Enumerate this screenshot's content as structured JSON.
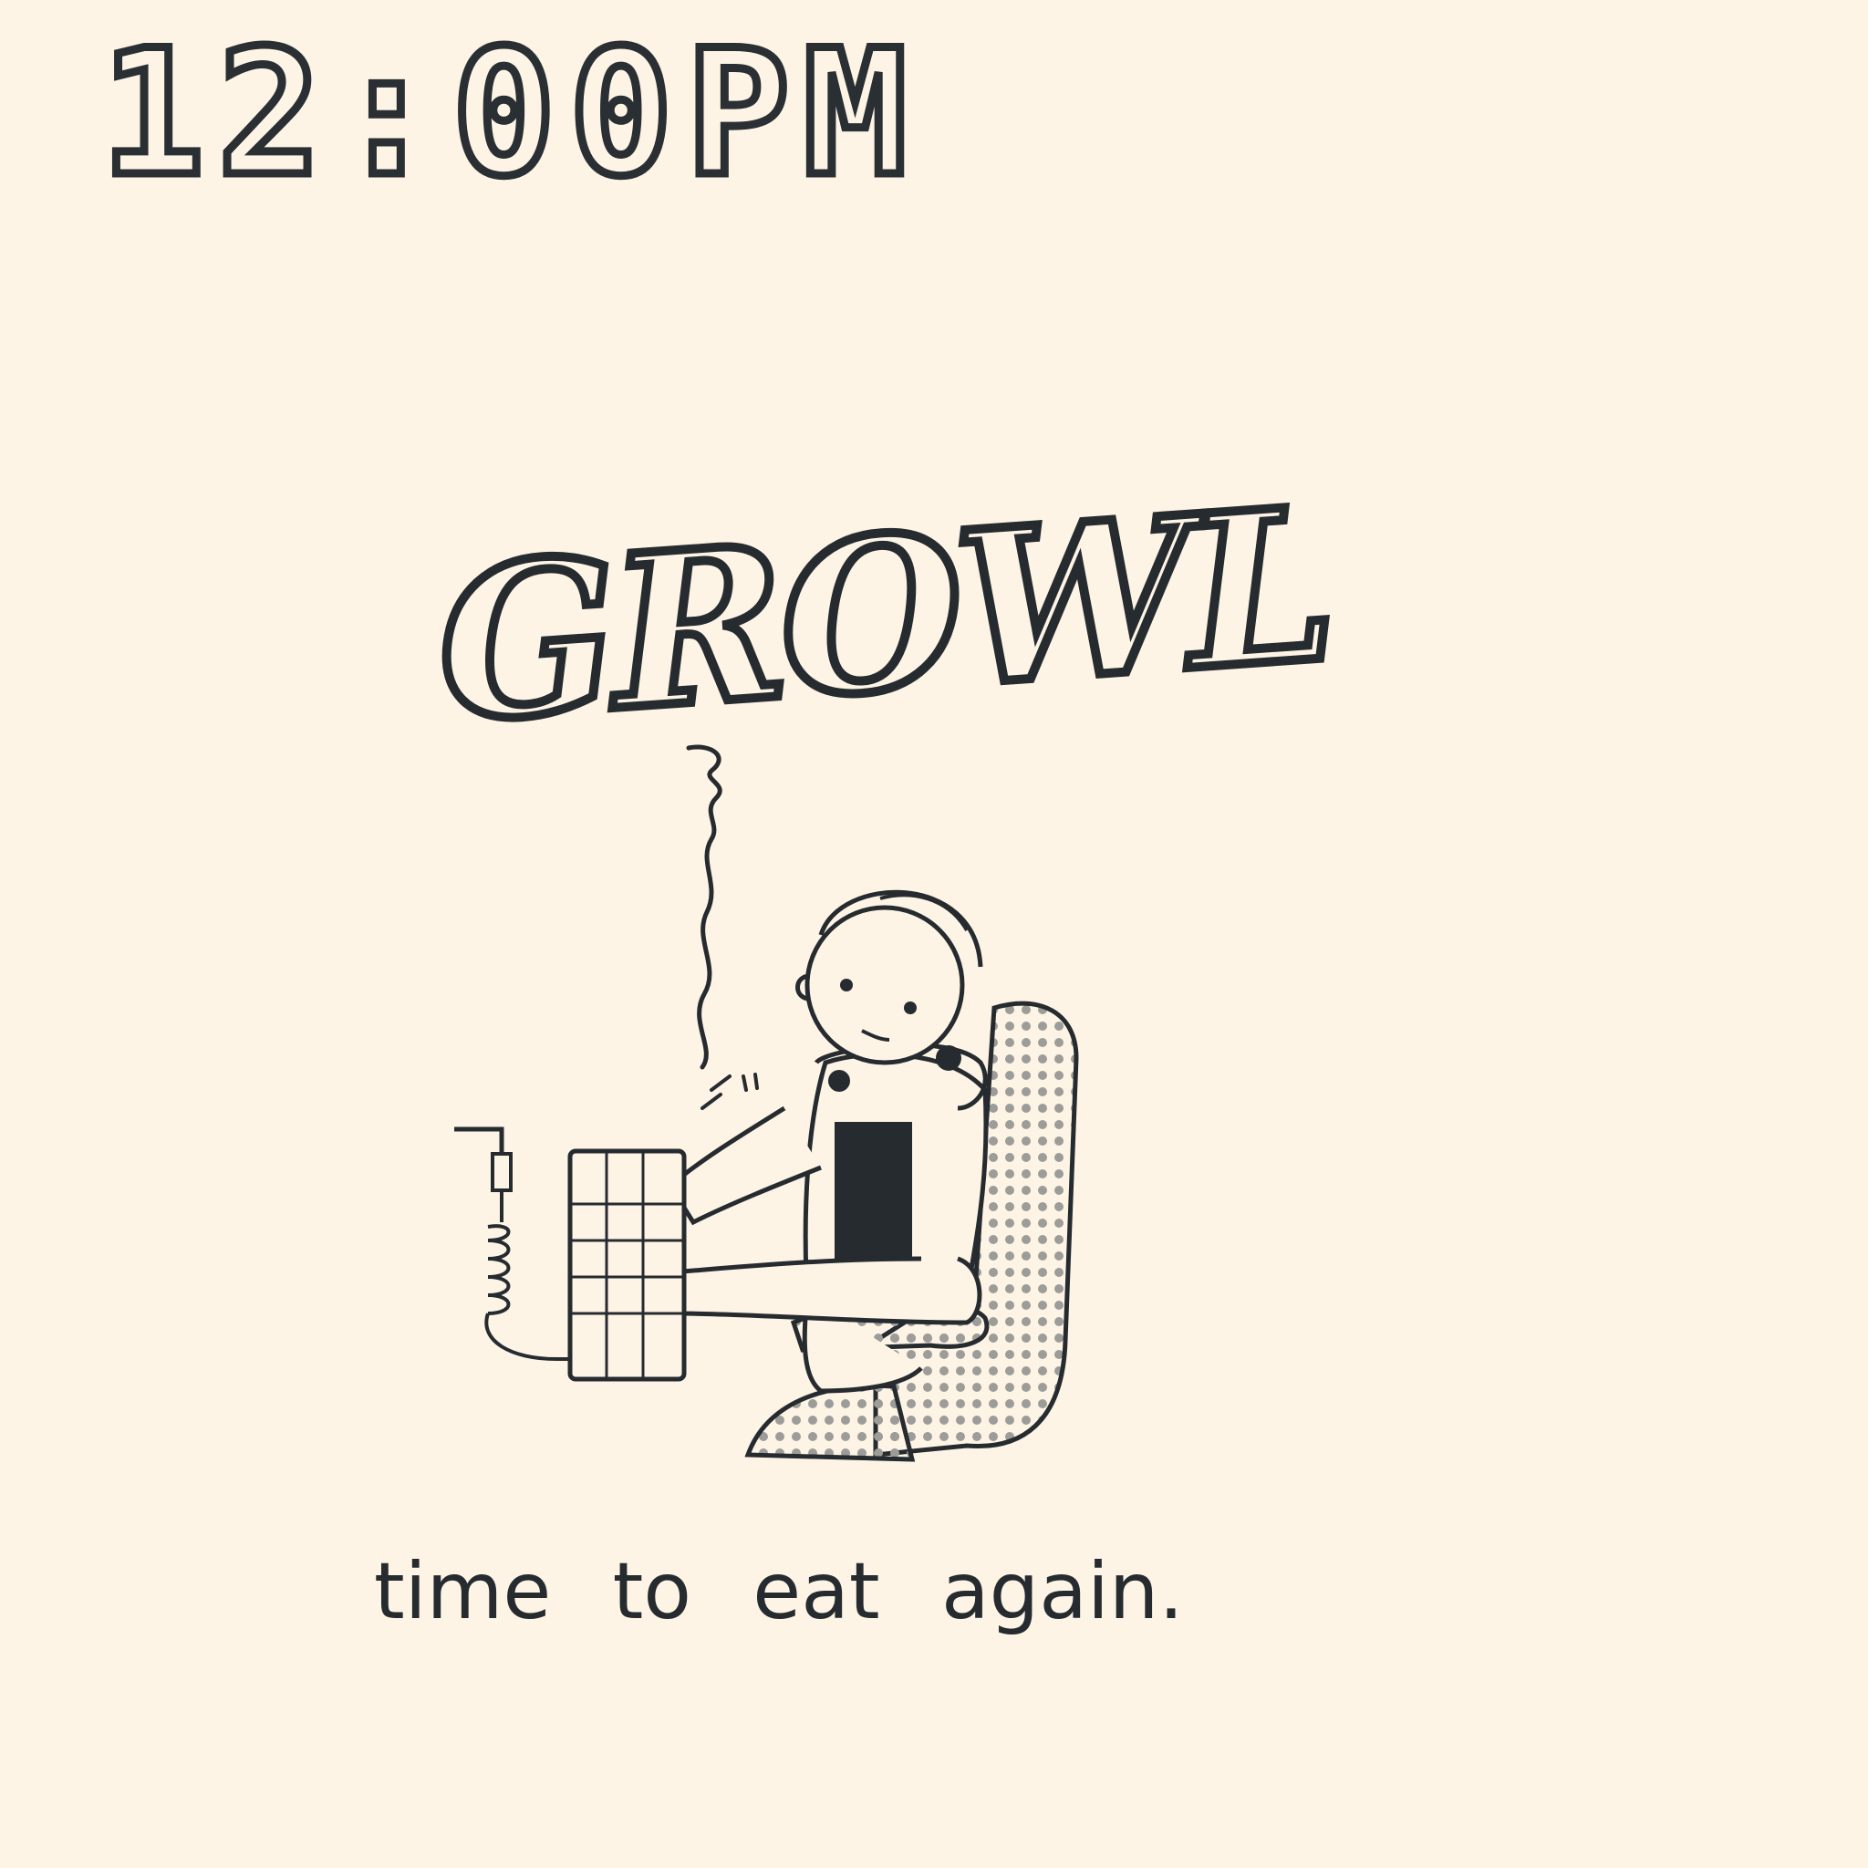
{
  "panel": {
    "time": "12:00PM",
    "sound_effect": "GROWL",
    "caption": "time to eat again."
  },
  "colors": {
    "background": "#fdf4e6",
    "ink": "#262b2f",
    "chair_dots": "#9c9c98"
  },
  "illustration": {
    "subject": "person wearing headphones seated in office chair typing on keyboard",
    "icons": [
      "headphones-icon",
      "keyboard-icon",
      "office-chair-icon",
      "coiled-cable-icon"
    ]
  }
}
